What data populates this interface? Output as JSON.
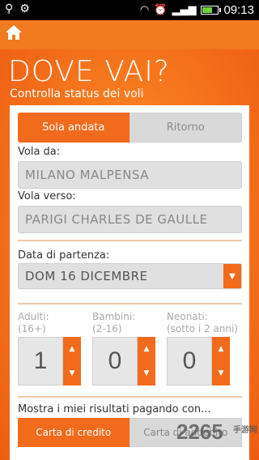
{
  "status_bar": {
    "time": "09:13",
    "icons": [
      "usb-icon",
      "android-debug-icon",
      "wifi-icon",
      "alarm-icon",
      "signal-icon",
      "battery-icon"
    ]
  },
  "header": {
    "home_icon": "home-icon"
  },
  "page": {
    "title": "DOVE VAI?",
    "subtitle": "Controlla status dei voli"
  },
  "trip_type": {
    "options": [
      "Sola andata",
      "Ritorno"
    ],
    "selected": "Sola andata"
  },
  "origin": {
    "label": "Vola da:",
    "value": "MILANO MALPENSA"
  },
  "destination": {
    "label": "Vola verso:",
    "value": "PARIGI CHARLES DE GAULLE"
  },
  "departure": {
    "label": "Data di partenza:",
    "value": "DOM 16 DICEMBRE"
  },
  "passengers": {
    "adults": {
      "label": "Adulti:",
      "sub": "(16+)",
      "value": "1"
    },
    "children": {
      "label": "Bambini:",
      "sub": "(2-16)",
      "value": "0"
    },
    "infants": {
      "label": "Neonati:",
      "sub": "(sotto i 2 anni)",
      "value": "0"
    }
  },
  "payment": {
    "label": "Mostra i miei risultati pagando con...",
    "options": [
      "Carta di credito",
      "Carta di addebito"
    ],
    "selected": "Carta di credito"
  },
  "watermark": {
    "text": "2265",
    "sub": "手游网"
  },
  "colors": {
    "accent": "#f26a1b",
    "field_bg": "#e0e0e0"
  }
}
